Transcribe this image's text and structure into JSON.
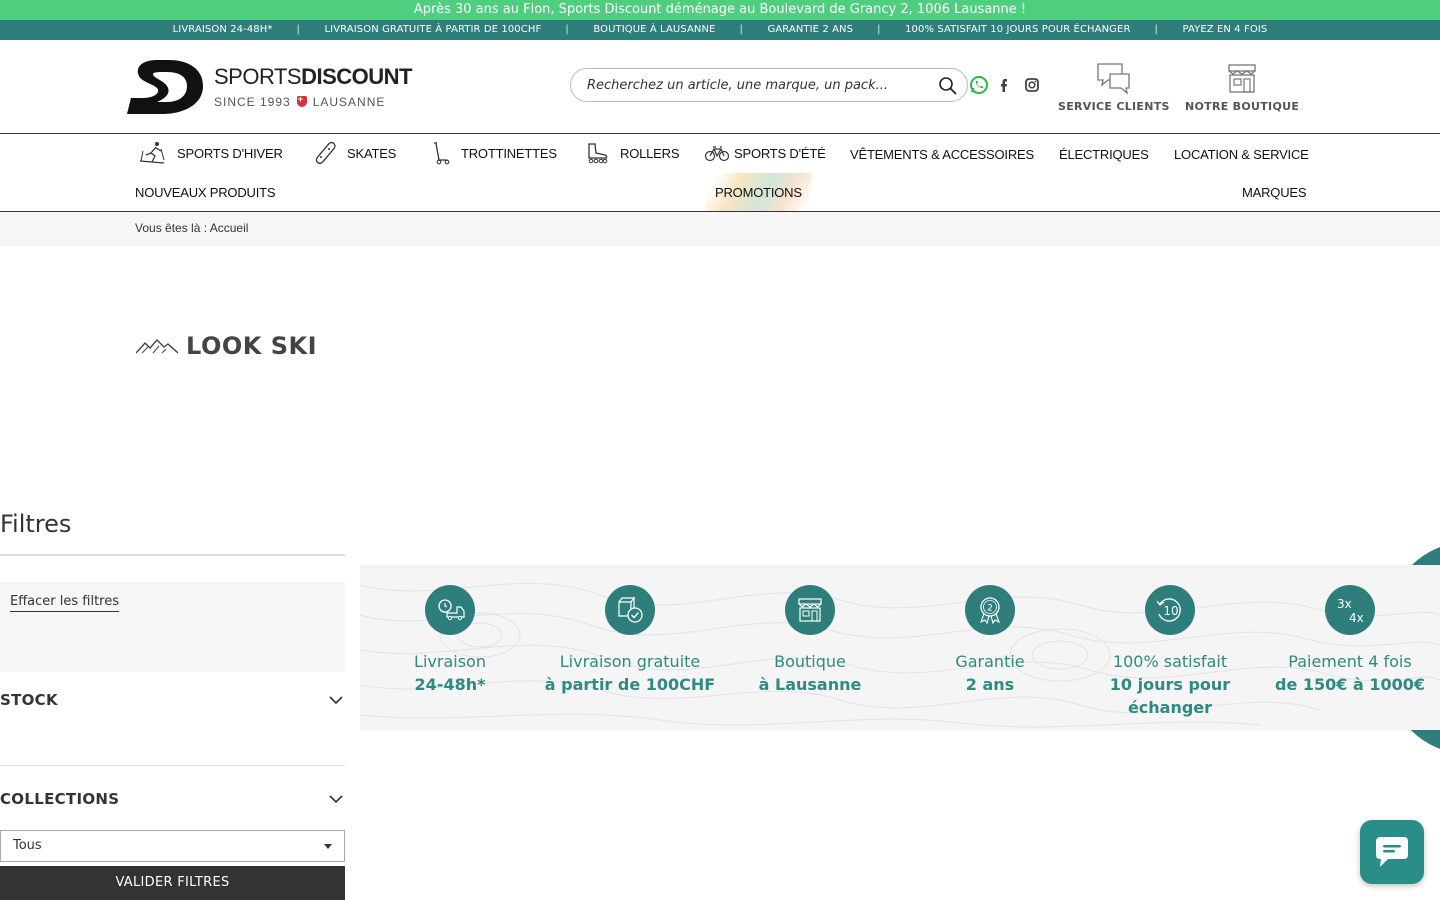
{
  "announcement": "Après 30 ans au Flon, Sports Discount déménage au Boulevard de Grancy 2, 1006 Lausanne !",
  "usp_bar": [
    "LIVRAISON 24-48H*",
    "LIVRAISON GRATUITE À PARTIR DE 100CHF",
    "BOUTIQUE À LAUSANNE",
    "GARANTIE 2 ANS",
    "100% SATISFAIT 10 JOURS POUR ÉCHANGER",
    "PAYEZ EN 4 FOIS"
  ],
  "logo": {
    "brand_light": "SPORTS",
    "brand_bold": "DISCOUNT",
    "since": "SINCE 1993",
    "city": "LAUSANNE"
  },
  "search": {
    "placeholder": "Recherchez un article, une marque, un pack..."
  },
  "header_buttons": {
    "service": "SERVICE CLIENTS",
    "boutique": "NOTRE BOUTIQUE"
  },
  "nav": {
    "sports_hiver": "SPORTS D'HIVER",
    "skates": "SKATES",
    "trottinettes": "TROTTINETTES",
    "rollers": "ROLLERS",
    "sports_ete": "SPORTS D'ÉTÉ",
    "vetements": "VÊTEMENTS & ACCESSOIRES",
    "electriques": "ÉLECTRIQUES",
    "location": "LOCATION & SERVICE",
    "nouveaux": "NOUVEAUX PRODUITS",
    "promotions": "PROMOTIONS",
    "marques": "MARQUES"
  },
  "breadcrumb": "Vous êtes là : Accueil",
  "page_title": "LOOK SKI",
  "filters": {
    "title": "Filtres",
    "clear": "Effacer les filtres",
    "stock": "STOCK",
    "collections": "COLLECTIONS",
    "select_value": "Tous",
    "validate": "VALIDER FILTRES"
  },
  "features": [
    {
      "l1": "Livraison",
      "l2": "24-48h*"
    },
    {
      "l1": "Livraison gratuite",
      "l2": "à partir de 100CHF"
    },
    {
      "l1": "Boutique",
      "l2": "à Lausanne"
    },
    {
      "l1": "Garantie",
      "l2": "2 ans"
    },
    {
      "l1": "100% satisfait",
      "l2": "10 jours pour échanger"
    },
    {
      "l1": "Paiement 4 fois",
      "l2": "de 150€ à 1000€"
    }
  ],
  "feature_icon_text": {
    "ten": "10",
    "two": "2",
    "three": "3x",
    "four": "4x"
  },
  "colors": {
    "green_banner": "#4fce7f",
    "teal": "#2e7f7c",
    "teal_text": "#2e8a82",
    "dark": "#333333"
  }
}
